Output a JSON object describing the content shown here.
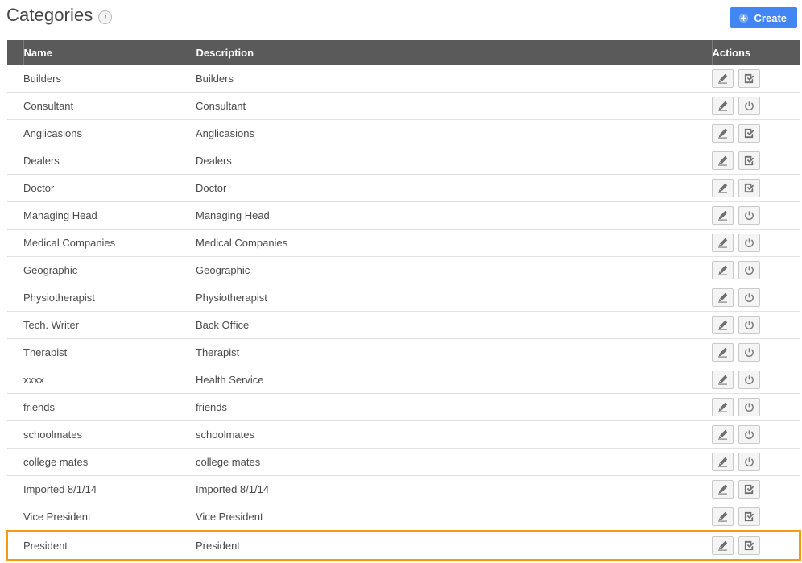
{
  "header": {
    "title": "Categories",
    "info_icon": "info-icon",
    "create_label": "Create",
    "create_icon": "plus-circle-icon",
    "create_color": "#4285f4"
  },
  "table": {
    "header_bg": "#5a5a5a",
    "highlight_color": "#f59c0b",
    "columns": [
      "",
      "Name",
      "Description",
      "Actions"
    ],
    "action_icons": {
      "edit": "pencil-icon",
      "activate": "checkbox-check-icon",
      "deactivate": "power-icon"
    },
    "rows": [
      {
        "name": "Builders",
        "description": "Builders",
        "second_action": "activate"
      },
      {
        "name": "Consultant",
        "description": "Consultant",
        "second_action": "deactivate"
      },
      {
        "name": "Anglicasions",
        "description": "Anglicasions",
        "second_action": "activate"
      },
      {
        "name": "Dealers",
        "description": "Dealers",
        "second_action": "activate"
      },
      {
        "name": "Doctor",
        "description": "Doctor",
        "second_action": "activate"
      },
      {
        "name": "Managing Head",
        "description": "Managing Head",
        "second_action": "deactivate"
      },
      {
        "name": "Medical Companies",
        "description": "Medical Companies",
        "second_action": "deactivate"
      },
      {
        "name": "Geographic",
        "description": "Geographic",
        "second_action": "deactivate"
      },
      {
        "name": "Physiotherapist",
        "description": "Physiotherapist",
        "second_action": "deactivate"
      },
      {
        "name": "Tech. Writer",
        "description": "Back Office",
        "second_action": "deactivate"
      },
      {
        "name": "Therapist",
        "description": "Therapist",
        "second_action": "deactivate"
      },
      {
        "name": "xxxx",
        "description": "Health Service",
        "second_action": "deactivate"
      },
      {
        "name": "friends",
        "description": "friends",
        "second_action": "deactivate"
      },
      {
        "name": "schoolmates",
        "description": "schoolmates",
        "second_action": "deactivate"
      },
      {
        "name": "college mates",
        "description": "college mates",
        "second_action": "deactivate"
      },
      {
        "name": "Imported 8/1/14",
        "description": "Imported 8/1/14",
        "second_action": "activate"
      },
      {
        "name": "Vice President",
        "description": "Vice President",
        "second_action": "activate"
      },
      {
        "name": "President",
        "description": "President",
        "second_action": "activate",
        "highlighted": true
      }
    ]
  }
}
